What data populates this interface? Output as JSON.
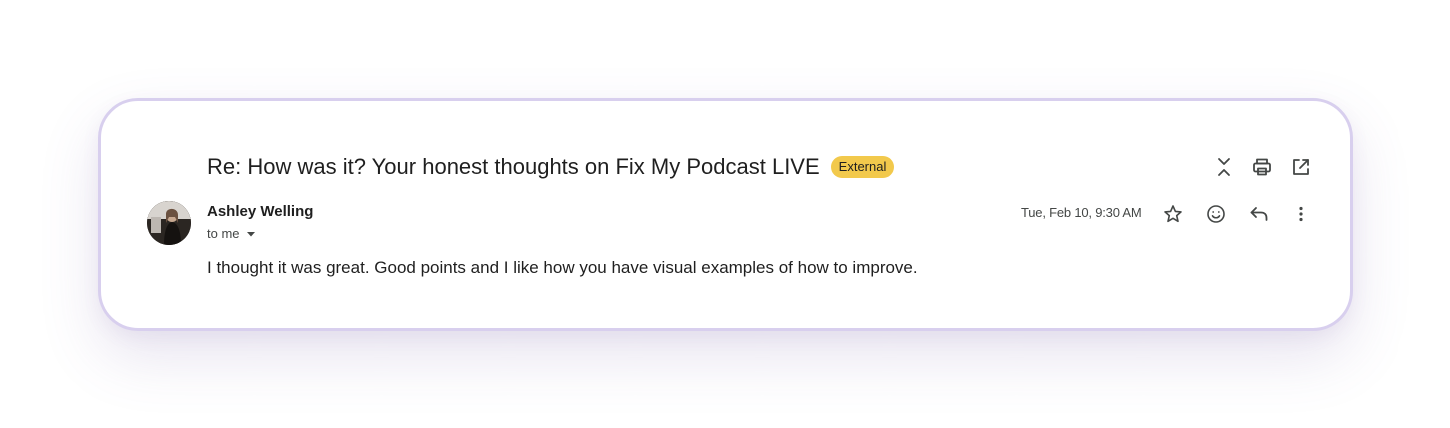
{
  "thread": {
    "subject": "Re: How was it? Your honest thoughts on Fix My Podcast LIVE",
    "badge": "External"
  },
  "thread_actions": {
    "collapse_icon": "collapse-all-icon",
    "print_icon": "print-icon",
    "open_new_window_icon": "open-in-new-icon"
  },
  "message": {
    "sender_name": "Ashley Welling",
    "recipient_label": "to me",
    "timestamp": "Tue, Feb 10, 9:30 AM",
    "body": "I thought it was great. Good points and I like how you have visual examples of how to improve."
  },
  "message_actions": {
    "star_icon": "star-icon",
    "emoji_icon": "emoji-react-icon",
    "reply_icon": "reply-icon",
    "more_icon": "more-vert-icon"
  },
  "colors": {
    "card_border": "#d8cfee",
    "badge_bg": "#f2c94c",
    "text_primary": "#1f1f1f",
    "text_secondary": "#444746"
  }
}
